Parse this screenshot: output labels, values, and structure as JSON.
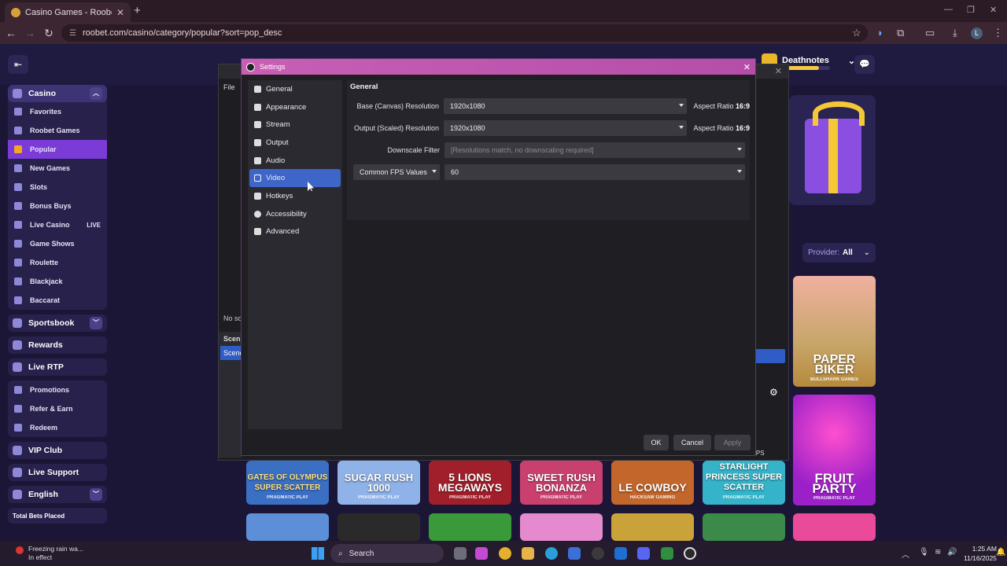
{
  "browser": {
    "tab_title": "Casino Games - Roobet Crypto",
    "url": "roobet.com/casino/category/popular?sort=pop_desc"
  },
  "site": {
    "username": "Deathnotes",
    "sidebar": {
      "casino_label": "Casino",
      "casino_items": [
        {
          "label": "Favorites"
        },
        {
          "label": "Roobet Games"
        },
        {
          "label": "Popular"
        },
        {
          "label": "New Games"
        },
        {
          "label": "Slots"
        },
        {
          "label": "Bonus Buys"
        },
        {
          "label": "Live Casino",
          "badge": "LIVE"
        },
        {
          "label": "Game Shows"
        },
        {
          "label": "Roulette"
        },
        {
          "label": "Blackjack"
        },
        {
          "label": "Baccarat"
        }
      ],
      "sportsbook_label": "Sportsbook",
      "rewards_label": "Rewards",
      "live_rtp_label": "Live RTP",
      "extra_items": [
        {
          "label": "Promotions"
        },
        {
          "label": "Refer & Earn"
        },
        {
          "label": "Redeem"
        }
      ],
      "vip_label": "VIP Club",
      "support_label": "Live Support",
      "language_label": "English",
      "total_bets_label": "Total Bets Placed"
    },
    "provider_filter": {
      "label": "Provider:",
      "value": "All"
    },
    "games_right": [
      {
        "name": "PAPER BIKER",
        "provider": "BULLSHARK GAMES"
      },
      {
        "name": "FRUIT PARTY",
        "provider": "PRAGMATIC PLAY"
      }
    ],
    "games_row": [
      {
        "name": "GATES OF OLYMPUS SUPER SCATTER",
        "provider": "PRAGMATIC PLAY"
      },
      {
        "name": "SUGAR RUSH 1000",
        "provider": "PRAGMATIC PLAY"
      },
      {
        "name": "5 LIONS MEGAWAYS",
        "provider": "PRAGMATIC PLAY"
      },
      {
        "name": "SWEET RUSH BONANZA",
        "provider": "PRAGMATIC PLAY"
      },
      {
        "name": "LE COWBOY",
        "provider": "HACKSAW GAMING"
      },
      {
        "name": "STARLIGHT PRINCESS SUPER SCATTER",
        "provider": "PRAGMATIC PLAY"
      }
    ]
  },
  "obs_window": {
    "menu_file": "File",
    "no_source": "No so",
    "scenes_label": "Scen",
    "scene_item": "Scene",
    "fps": "FPS"
  },
  "settings": {
    "title": "Settings",
    "nav": [
      {
        "label": "General",
        "icon": "gear-icon"
      },
      {
        "label": "Appearance",
        "icon": "palette-icon"
      },
      {
        "label": "Stream",
        "icon": "antenna-icon"
      },
      {
        "label": "Output",
        "icon": "output-icon"
      },
      {
        "label": "Audio",
        "icon": "speaker-icon"
      },
      {
        "label": "Video",
        "icon": "monitor-icon"
      },
      {
        "label": "Hotkeys",
        "icon": "keyboard-icon"
      },
      {
        "label": "Accessibility",
        "icon": "accessibility-icon"
      },
      {
        "label": "Advanced",
        "icon": "wrench-icon"
      }
    ],
    "active_nav": "Video",
    "section_title": "General",
    "base_label": "Base (Canvas) Resolution",
    "base_value": "1920x1080",
    "base_aspect_label": "Aspect Ratio",
    "base_aspect_value": "16:9",
    "output_label": "Output (Scaled) Resolution",
    "output_value": "1920x1080",
    "output_aspect_label": "Aspect Ratio",
    "output_aspect_value": "16:9",
    "downscale_label": "Downscale Filter",
    "downscale_value": "[Resolutions match, no downscaling required]",
    "fps_type": "Common FPS Values",
    "fps_value": "60",
    "ok": "OK",
    "cancel": "Cancel",
    "apply": "Apply"
  },
  "taskbar": {
    "weather_line1": "Freezing rain wa...",
    "weather_line2": "In effect",
    "search_placeholder": "Search",
    "time": "1:25 AM",
    "date": "11/16/2025"
  }
}
